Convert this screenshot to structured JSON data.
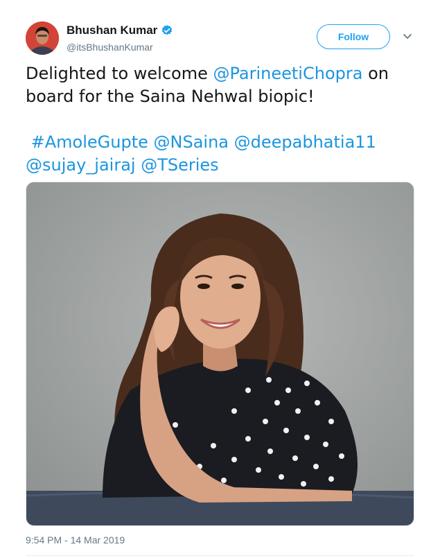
{
  "author": {
    "display_name": "Bhushan Kumar",
    "handle": "@itsBhushanKumar",
    "verified": true
  },
  "actions": {
    "follow_label": "Follow",
    "menu_icon": "chevron-down-icon"
  },
  "tweet": {
    "text_intro": "Delighted to welcome ",
    "mention_parineeti": "@ParineetiChopra",
    "text_after_mention": " on",
    "text_line2": "board for the Saina Nehwal biopic!",
    "hashtag_amole": "#AmoleGupte",
    "mention_nsaina": "@NSaina",
    "mention_deepa": "@deepabhatia11",
    "mention_sujay": "@sujay_jairaj",
    "mention_tseries": "@TSeries"
  },
  "media": {
    "icon": "photo"
  },
  "timestamp": "9:54 PM - 14 Mar 2019",
  "colors": {
    "accent": "#1da1f2",
    "link": "#1b95e0",
    "muted": "#657786",
    "text": "#14171a"
  }
}
